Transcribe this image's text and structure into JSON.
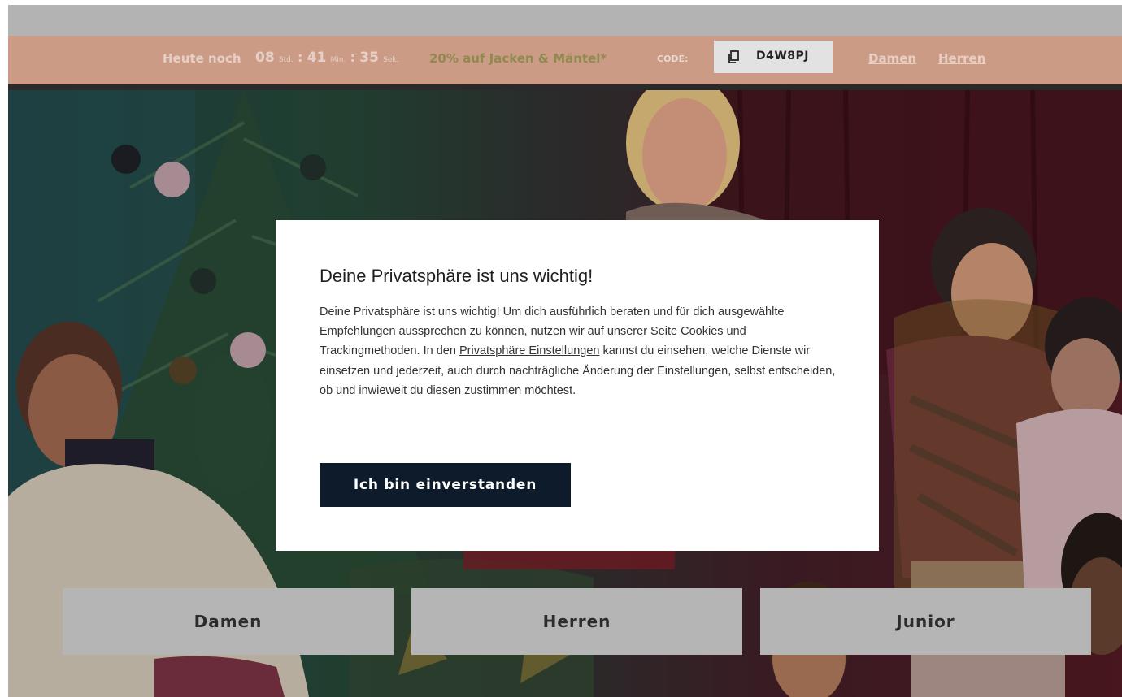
{
  "promo": {
    "lead": "Heute noch",
    "hours": "08",
    "hours_unit": "Std.",
    "minutes": "41",
    "minutes_unit": "Min.",
    "seconds": "35",
    "seconds_unit": "Sek.",
    "colon": ":",
    "offer": "20% auf Jacken & Mäntel*",
    "code_label": "CODE:",
    "code": "D4W8PJ",
    "links": [
      "Damen",
      "Herren"
    ]
  },
  "modal": {
    "title": "Deine Privatsphäre ist uns wichtig!",
    "body_before": "Deine Privatsphäre ist uns wichtig! Um dich ausführlich beraten und für dich ausgewählte Empfehlungen aussprechen zu können, nutzen wir auf unserer Seite Cookies und Trackingmethoden. In den ",
    "body_link": "Privatsphäre Einstellungen",
    "body_after": " kannst du einsehen, welche Dienste wir einsetzen und jederzeit, auch durch nachträgliche Änderung der Einstellungen, selbst entscheiden, ob und inwieweit du diesen zustimmen möchtest.",
    "accept_label": "Ich bin einverstanden"
  },
  "categories": [
    "Damen",
    "Herren",
    "Junior"
  ],
  "icons": {
    "copy": "copy-icon"
  },
  "colors": {
    "promo_bar": "#cc9b86",
    "offer_text": "#8f8a4e",
    "accept_button": "#0d1b2a",
    "category_button": "#b5b5b5"
  }
}
